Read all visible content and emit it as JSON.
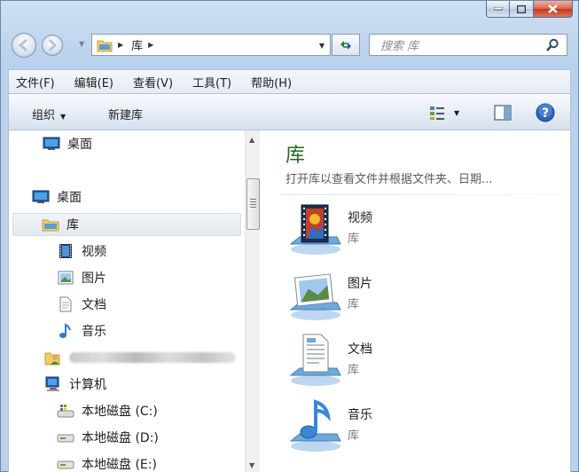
{
  "window": {
    "caption": {
      "minimize": "▬",
      "maximize": "▢",
      "close": "✕"
    }
  },
  "address": {
    "crumbs": [
      "库"
    ],
    "search_placeholder": "搜索 库"
  },
  "menu": {
    "items": [
      "文件(F)",
      "编辑(E)",
      "查看(V)",
      "工具(T)",
      "帮助(H)"
    ]
  },
  "commands": {
    "organize_label": "组织",
    "new_library_label": "新建库"
  },
  "nav": {
    "items": [
      {
        "label": "桌面",
        "icon": "desktop-icon"
      },
      {
        "label": "桌面",
        "icon": "desktop-icon"
      },
      {
        "label": "库",
        "icon": "library-folder-icon",
        "selected": true
      },
      {
        "label": "视频",
        "icon": "video-library-icon"
      },
      {
        "label": "图片",
        "icon": "picture-library-icon"
      },
      {
        "label": "文档",
        "icon": "document-library-icon"
      },
      {
        "label": "音乐",
        "icon": "music-library-icon"
      },
      {
        "label": "",
        "icon": "user-folder-icon",
        "redacted": true
      },
      {
        "label": "计算机",
        "icon": "computer-icon"
      },
      {
        "label": "本地磁盘 (C:)",
        "icon": "system-drive-icon"
      },
      {
        "label": "本地磁盘 (D:)",
        "icon": "drive-icon"
      },
      {
        "label": "本地磁盘 (E:)",
        "icon": "drive-icon"
      }
    ]
  },
  "main": {
    "title": "库",
    "subtitle": "打开库以查看文件并根据文件夹、日期...",
    "libraries": [
      {
        "name": "视频",
        "type": "库",
        "icon": "video-library-icon"
      },
      {
        "name": "图片",
        "type": "库",
        "icon": "picture-library-icon"
      },
      {
        "name": "文档",
        "type": "库",
        "icon": "document-library-icon"
      },
      {
        "name": "音乐",
        "type": "库",
        "icon": "music-library-icon"
      }
    ]
  },
  "colors": {
    "title_green": "#1e6d1e",
    "frame_blue": "#b9d1ec",
    "close_red": "#c2371c"
  }
}
